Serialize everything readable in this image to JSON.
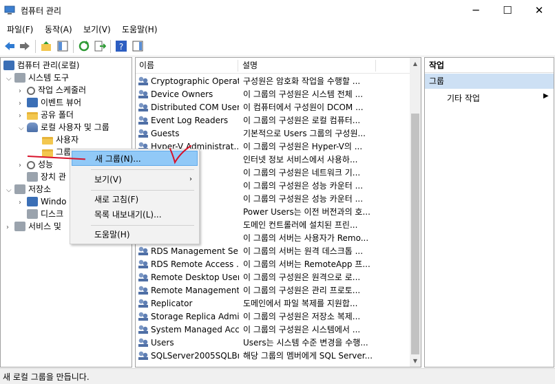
{
  "window": {
    "title": "컴퓨터 관리",
    "minimize": "─",
    "maximize": "☐",
    "close": "✕"
  },
  "menubar": [
    "파일(F)",
    "동작(A)",
    "보기(V)",
    "도움말(H)"
  ],
  "tree": {
    "root": "컴퓨터 관리(로컬)",
    "system_tools": "시스템 도구",
    "task_scheduler": "작업 스케줄러",
    "event_viewer": "이벤트 뷰어",
    "shared_folders": "공유 폴더",
    "local_users_groups": "로컬 사용자 및 그룹",
    "users": "사용자",
    "groups": "그룹",
    "performance": "성능",
    "device_manager": "장치 관",
    "storage": "저장소",
    "windows_backup": "Windo",
    "disk_mgmt": "디스크",
    "services": "서비스 및"
  },
  "list": {
    "headers": [
      "이름",
      "설명"
    ],
    "rows": [
      [
        "Cryptographic Operat...",
        "구성원은 암호화 작업을 수행할 ..."
      ],
      [
        "Device Owners",
        "이 그룹의 구성원은 시스템 전체 ..."
      ],
      [
        "Distributed COM Users",
        "이 컴퓨터에서 구성원이 DCOM ..."
      ],
      [
        "Event Log Readers",
        "이 그룹의 구성원은 로컬 컴퓨터..."
      ],
      [
        "Guests",
        "기본적으로 Users 그룹의 구성원..."
      ],
      [
        "Hyper-V Administrat...",
        "이 그룹의 구성원은 Hyper-V의 ..."
      ],
      [
        "",
        "인터넷 정보 서비스에서 사용하..."
      ],
      [
        "figuratio...",
        "이 그룹의 구성원은 네트워크 기..."
      ],
      [
        "Log Users",
        "이 그룹의 구성원은 성능 카운터 ..."
      ],
      [
        "Monitor...",
        "이 그룹의 구성원은 성능 카운터 ..."
      ],
      [
        "",
        "Power Users는 이전 버전과의 호..."
      ],
      [
        "rs",
        "도메인 컨트롤러에 설치된 프린..."
      ],
      [
        "t Servers",
        "이 그룹의 서버는 사용자가 Remo..."
      ],
      [
        "RDS Management Se...",
        "이 그룹의 서버는 원격 데스크톱 ..."
      ],
      [
        "RDS Remote Access ...",
        "이 그룹의 서버는 RemoteApp 프..."
      ],
      [
        "Remote Desktop Users",
        "이 그룹의 구성원은 원격으로 로..."
      ],
      [
        "Remote Management...",
        "이 그룹의 구성원은 관리 프로토..."
      ],
      [
        "Replicator",
        "도메인에서 파일 복제를 지원합..."
      ],
      [
        "Storage Replica Admi...",
        "이 그룹의 구성원은 저장소 복제..."
      ],
      [
        "System Managed Acc...",
        "이 그룹의 구성원은 시스템에서 ..."
      ],
      [
        "Users",
        "Users는 시스템 수준 변경을 수행..."
      ],
      [
        "SQLServer2005SQLBr...",
        "해당 그룹의 멤버에게 SQL Server..."
      ]
    ]
  },
  "actions": {
    "header": "작업",
    "selected": "그룹",
    "other": "기타 작업",
    "other_arrow": "▶"
  },
  "context_menu": {
    "new_group": "새 그룹(N)...",
    "view": "보기(V)",
    "view_arrow": "›",
    "refresh": "새로 고침(F)",
    "export": "목록 내보내기(L)...",
    "help": "도움말(H)"
  },
  "status": "새 로컬 그룹을 만듭니다.",
  "colors": {
    "highlight": "#91c9f7",
    "selection": "#cde0f4",
    "annotation": "#d8122a"
  }
}
